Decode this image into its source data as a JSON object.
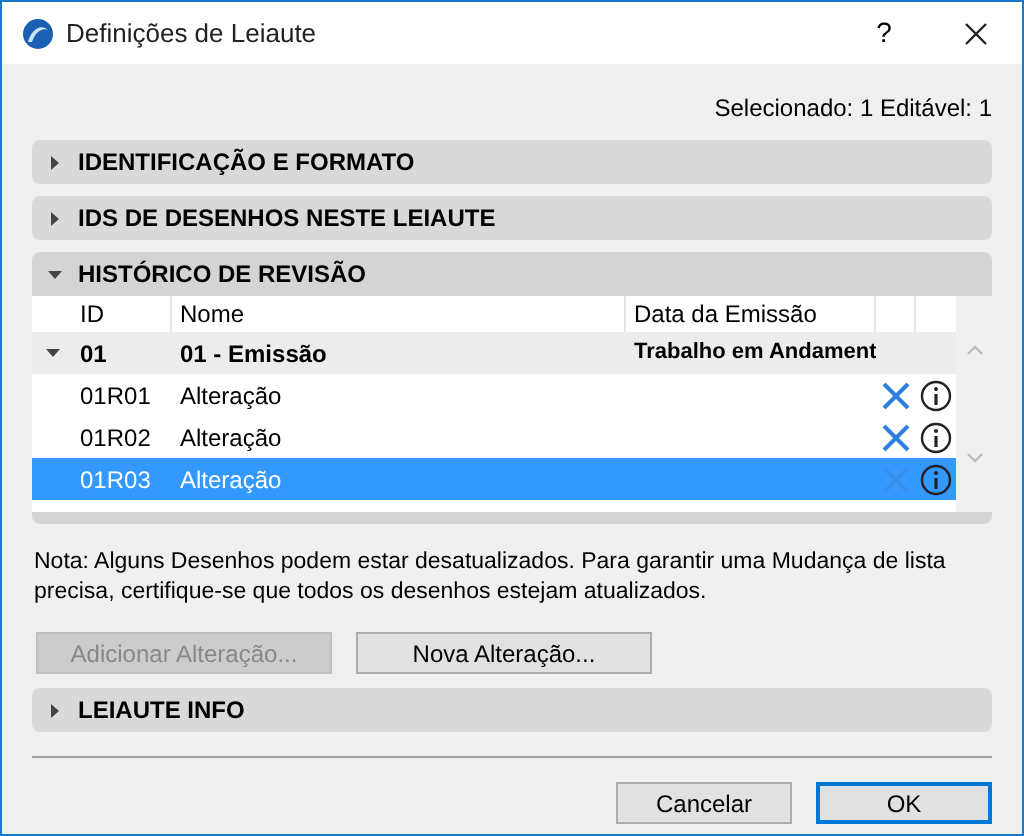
{
  "window": {
    "title": "Definições de Leiaute",
    "help": "?"
  },
  "status": "Selecionado: 1 Editável: 1",
  "sections_top": [
    {
      "label": "IDENTIFICAÇÃO E FORMATO",
      "expanded": false
    },
    {
      "label": "IDS DE DESENHOS NESTE LEIAUTE",
      "expanded": false
    },
    {
      "label": "HISTÓRICO DE REVISÃO",
      "expanded": true
    }
  ],
  "table": {
    "columns": [
      "ID",
      "Nome",
      "Data da Emissão"
    ],
    "groups": [
      {
        "id": "01",
        "name": "01 - Emissão",
        "date": "Trabalho em Andament",
        "expanded": true,
        "rows": [
          {
            "id": "01R01",
            "name": "Alteração",
            "selected": false
          },
          {
            "id": "01R02",
            "name": "Alteração",
            "selected": false
          },
          {
            "id": "01R03",
            "name": "Alteração",
            "selected": true
          }
        ]
      }
    ]
  },
  "note": "Nota: Alguns Desenhos podem estar desatualizados. Para garantir uma Mudança de lista precisa, certifique-se que todos os desenhos estejam atualizados.",
  "actions": [
    {
      "label": "Adicionar Alteração...",
      "disabled": true
    },
    {
      "label": "Nova Alteração...",
      "disabled": false
    }
  ],
  "sections_bottom": [
    {
      "label": "LEIAUTE INFO",
      "expanded": false
    }
  ],
  "buttons": [
    {
      "label": "Cancelar",
      "default": false
    },
    {
      "label": "OK",
      "default": true
    }
  ]
}
